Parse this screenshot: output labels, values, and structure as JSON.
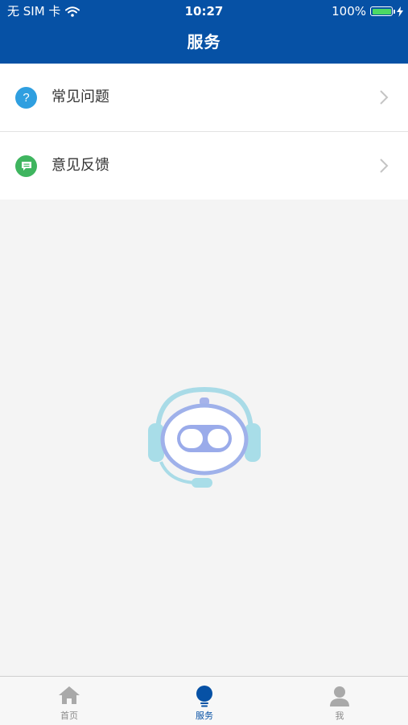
{
  "status_bar": {
    "carrier": "无 SIM 卡",
    "time": "10:27",
    "battery_percent": "100%",
    "battery_level": 1.0
  },
  "nav": {
    "title": "服务"
  },
  "service_list": [
    {
      "label": "常见问题",
      "icon": "question-icon",
      "icon_color": "#2f9fe0"
    },
    {
      "label": "意见反馈",
      "icon": "feedback-icon",
      "icon_color": "#3fb55f"
    }
  ],
  "tabs": [
    {
      "label": "首页",
      "icon": "home-icon",
      "active": false
    },
    {
      "label": "服务",
      "icon": "bulb-icon",
      "active": true
    },
    {
      "label": "我",
      "icon": "person-icon",
      "active": false
    }
  ],
  "colors": {
    "brand": "#0651a5",
    "background": "#f4f4f4",
    "inactive_tab": "#8a8a8a"
  }
}
